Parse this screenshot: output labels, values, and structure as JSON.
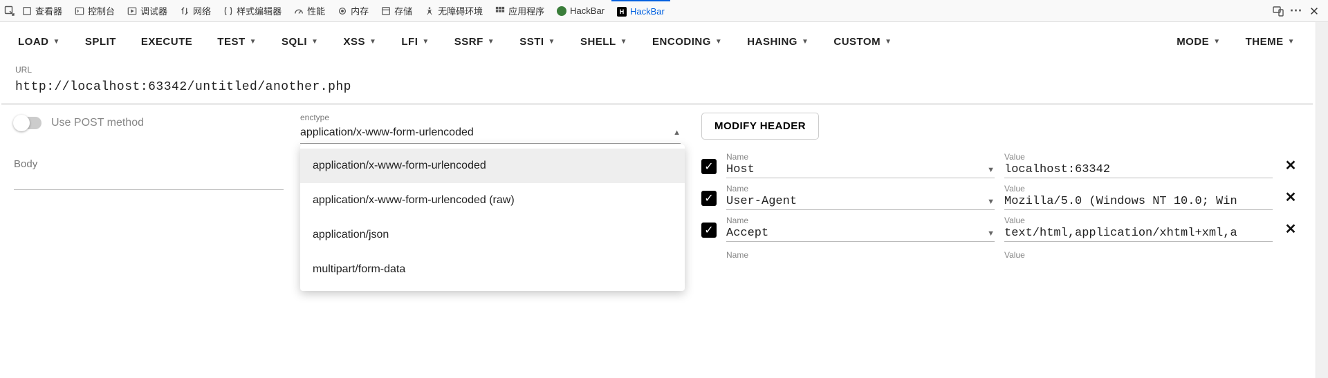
{
  "devtools": {
    "tabs": [
      "查看器",
      "控制台",
      "调试器",
      "网络",
      "样式编辑器",
      "性能",
      "内存",
      "存储",
      "无障碍环境",
      "应用程序",
      "HackBar",
      "HackBar"
    ],
    "active_index": 11
  },
  "toolbar": {
    "load": "LOAD",
    "split": "SPLIT",
    "execute": "EXECUTE",
    "test": "TEST",
    "sqli": "SQLI",
    "xss": "XSS",
    "lfi": "LFI",
    "ssrf": "SSRF",
    "ssti": "SSTI",
    "shell": "SHELL",
    "encoding": "ENCODING",
    "hashing": "HASHING",
    "custom": "CUSTOM",
    "mode": "MODE",
    "theme": "THEME"
  },
  "url": {
    "label": "URL",
    "value": "http://localhost:63342/untitled/another.php"
  },
  "post_toggle": {
    "label": "Use POST method"
  },
  "body": {
    "label": "Body"
  },
  "enctype": {
    "label": "enctype",
    "value": "application/x-www-form-urlencoded",
    "options": [
      "application/x-www-form-urlencoded",
      "application/x-www-form-urlencoded (raw)",
      "application/json",
      "multipart/form-data"
    ]
  },
  "modify_header_btn": "MODIFY HEADER",
  "header_labels": {
    "name": "Name",
    "value": "Value"
  },
  "headers": [
    {
      "name": "Host",
      "value": "localhost:63342"
    },
    {
      "name": "User-Agent",
      "value": "Mozilla/5.0 (Windows NT 10.0; Win"
    },
    {
      "name": "Accept",
      "value": "text/html,application/xhtml+xml,a"
    }
  ]
}
